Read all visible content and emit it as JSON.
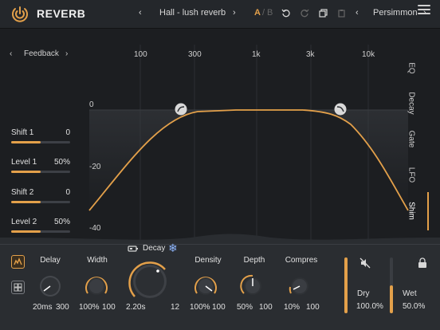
{
  "header": {
    "title": "REVERB",
    "preset_prev": "‹",
    "preset_name": "Hall - lush reverb",
    "preset_next": "›",
    "ab_a": "A",
    "ab_sep": "/",
    "ab_b": "B",
    "style_prev": "‹",
    "style_name": "Persimmon",
    "style_next": "›",
    "accent": "#e3a04a"
  },
  "graph": {
    "mode_prev": "‹",
    "mode_label": "Feedback",
    "mode_next": "›",
    "freq_labels": [
      "100",
      "300",
      "1k",
      "3k",
      "10k"
    ],
    "db_labels": [
      "0",
      "-20",
      "-40"
    ],
    "tabs": [
      "EQ",
      "Decay",
      "Gate",
      "LFO",
      "Shim"
    ],
    "active_tab": "Shim"
  },
  "params": [
    {
      "name": "Shift 1",
      "value": "0",
      "level": 0.5
    },
    {
      "name": "Level 1",
      "value": "50%",
      "level": 0.5
    },
    {
      "name": "Shift 2",
      "value": "0",
      "level": 0.5
    },
    {
      "name": "Level 2",
      "value": "50%",
      "level": 0.5
    }
  ],
  "controls": {
    "decay_label": "Decay",
    "knobs": [
      {
        "label": "Delay",
        "v1": "20ms",
        "v2": "300"
      },
      {
        "label": "Width",
        "v1": "100%",
        "v2": "100"
      },
      {
        "label": "",
        "v1": "2.20s",
        "v2": "12"
      },
      {
        "label": "Density",
        "v1": "100%",
        "v2": "100"
      },
      {
        "label": "Depth",
        "v1": "50%",
        "v2": "100"
      },
      {
        "label": "Compres",
        "v1": "10%",
        "v2": "100"
      }
    ],
    "dry_label": "Dry",
    "dry_value": "100.0%",
    "wet_label": "Wet",
    "wet_value": "50.0%",
    "dry_level": 1.0,
    "wet_level": 0.5
  }
}
